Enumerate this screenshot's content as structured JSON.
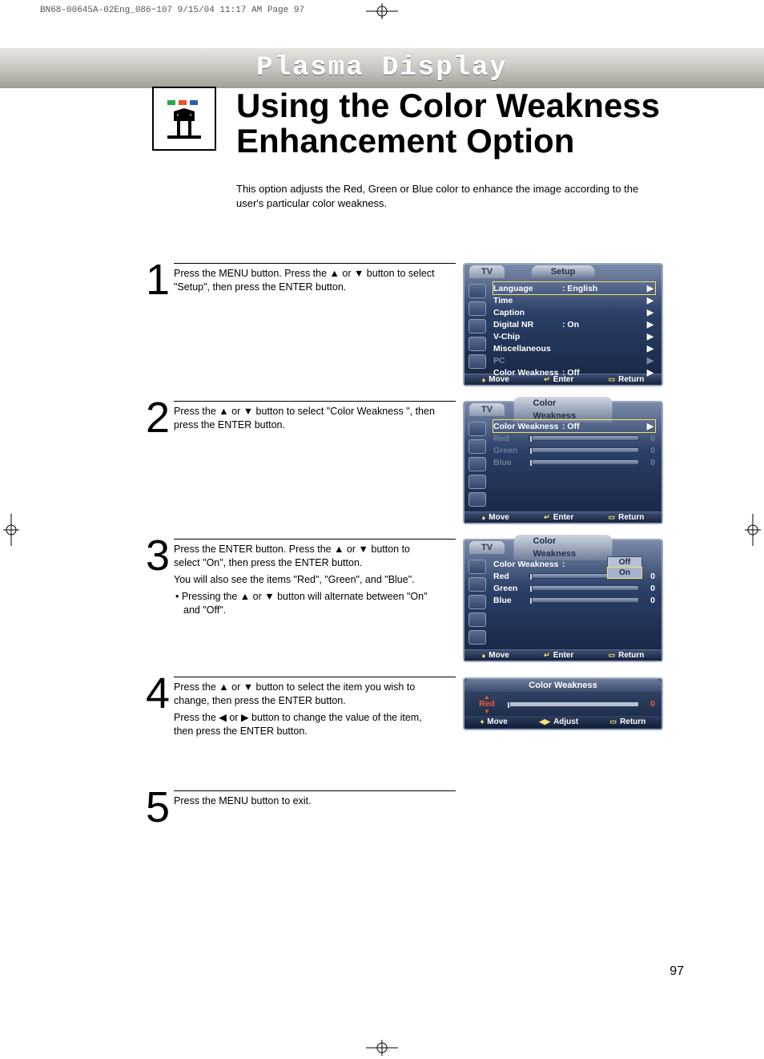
{
  "print_slug": "BN68-00645A-02Eng_086~107  9/15/04  11:17 AM  Page 97",
  "banner_title": "Plasma Display",
  "page_title": "Using the Color Weakness Enhancement Option",
  "intro": "This option adjusts the Red, Green or Blue color to enhance the image according to the user's particular color weakness.",
  "steps": {
    "s1": {
      "num": "1",
      "text": "Press the MENU button. Press the ▲ or ▼ button to select \"Setup\", then press the ENTER button."
    },
    "s2": {
      "num": "2",
      "text": "Press the ▲ or ▼ button to select \"Color Weakness \", then press the ENTER button."
    },
    "s3": {
      "num": "3",
      "l1": "Press the ENTER button. Press the ▲ or ▼ button to select \"On\", then press the ENTER button.",
      "l2": "You will also see the items \"Red\", \"Green\", and \"Blue\".",
      "bullet": "• Pressing the ▲ or ▼ button will alternate between \"On\" and \"Off\"."
    },
    "s4": {
      "num": "4",
      "l1": "Press the ▲ or ▼ button to select the item you wish to change, then press the ENTER button.",
      "l2": "Press the ◀ or ▶ button to change the value of the item, then press the ENTER button."
    },
    "s5": {
      "num": "5",
      "text": "Press the MENU button to exit."
    }
  },
  "osd1": {
    "tv": "TV",
    "title": "Setup",
    "rows": [
      {
        "label": "Language",
        "value": ":  English",
        "hl": true
      },
      {
        "label": "Time",
        "value": ""
      },
      {
        "label": "Caption",
        "value": ""
      },
      {
        "label": "Digital NR",
        "value": ":  On"
      },
      {
        "label": "V-Chip",
        "value": ""
      },
      {
        "label": "Miscellaneous",
        "value": ""
      },
      {
        "label": "PC",
        "value": "",
        "dim": true
      },
      {
        "label": "Color Weakness",
        "value": ":  Off"
      }
    ],
    "foot": {
      "move": "Move",
      "enter": "Enter",
      "ret": "Return"
    }
  },
  "osd2": {
    "tv": "TV",
    "title": "Color Weakness",
    "cw_label": "Color Weakness",
    "cw_value": ":  Off",
    "rows": [
      {
        "label": "Red",
        "val": "0"
      },
      {
        "label": "Green",
        "val": "0"
      },
      {
        "label": "Blue",
        "val": "0"
      }
    ],
    "foot": {
      "move": "Move",
      "enter": "Enter",
      "ret": "Return"
    }
  },
  "osd3": {
    "tv": "TV",
    "title": "Color Weakness",
    "cw_label": "Color Weakness",
    "cw_value": ":",
    "popup": {
      "off": "Off",
      "on": "On"
    },
    "rows": [
      {
        "label": "Red",
        "val": "0"
      },
      {
        "label": "Green",
        "val": "0"
      },
      {
        "label": "Blue",
        "val": "0"
      }
    ],
    "foot": {
      "move": "Move",
      "enter": "Enter",
      "ret": "Return"
    }
  },
  "osd4": {
    "title": "Color Weakness",
    "label": "Red",
    "value": "0",
    "foot": {
      "move": "Move",
      "adjust": "Adjust",
      "ret": "Return"
    }
  },
  "page_number": "97"
}
